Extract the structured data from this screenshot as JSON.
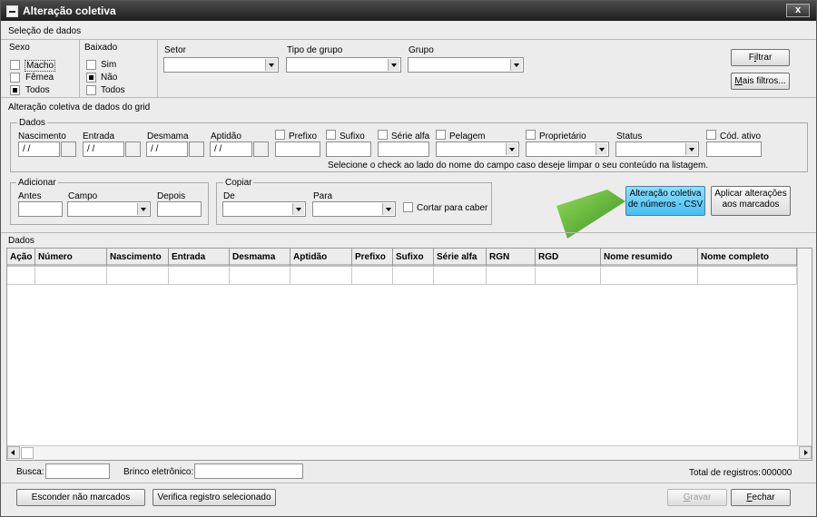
{
  "window": {
    "title": "Alteração coletiva",
    "close": "x"
  },
  "selecao": {
    "header": "Seleção de dados",
    "sexo": {
      "label": "Sexo",
      "options": [
        "Macho",
        "Fêmea",
        "Todos"
      ],
      "checked": [
        false,
        false,
        true
      ]
    },
    "baixado": {
      "label": "Baixado",
      "options": [
        "Sim",
        "Não",
        "Todos"
      ],
      "checked": [
        false,
        true,
        false
      ]
    },
    "setor": "Setor",
    "tipo_grupo": "Tipo de grupo",
    "grupo": "Grupo",
    "filtrar": {
      "pre": "F",
      "u": "i",
      "post": "ltrar"
    },
    "mais_filtros": {
      "pre": "",
      "u": "M",
      "post": "ais filtros..."
    }
  },
  "alteracao": {
    "header": "Alteração coletiva de dados do grid",
    "dados_legend": "Dados",
    "nascimento": "Nascimento",
    "entrada": "Entrada",
    "desmama": "Desmama",
    "aptidao": "Aptidão",
    "date_value": " / /",
    "prefixo": "Prefixo",
    "sufixo": "Sufixo",
    "serie_alfa": "Série alfa",
    "pelagem": "Pelagem",
    "proprietario": "Proprietário",
    "status": "Status",
    "cod_ativo": "Cód. ativo",
    "hint": "Selecione o check ao lado do nome do campo caso deseje limpar o seu conteúdo na listagem."
  },
  "adicionar": {
    "legend": "Adicionar",
    "antes": "Antes",
    "campo": "Campo",
    "depois": "Depois"
  },
  "copiar": {
    "legend": "Copiar",
    "de": "De",
    "para": "Para",
    "cortar": "Cortar para caber"
  },
  "actions": {
    "csv_line1": "Alteração coletiva",
    "csv_line2": "de números - CSV",
    "aplicar_line1": "Aplicar alterações",
    "aplicar_line2": "aos marcados"
  },
  "grid": {
    "header": "Dados",
    "columns": [
      "Ação",
      "Número",
      "Nascimento",
      "Entrada",
      "Desmama",
      "Aptidão",
      "Prefixo",
      "Sufixo",
      "Série alfa",
      "RGN",
      "RGD",
      "Nome resumido",
      "Nome completo"
    ]
  },
  "footer": {
    "busca": "Busca:",
    "brinco": "Brinco eletrônico:",
    "total_label": "Total de registros:",
    "total_value": "000000",
    "esconder": "Esconder não marcados",
    "verifica": "Verifica registro selecionado",
    "gravar": {
      "pre": "",
      "u": "G",
      "post": "ravar"
    },
    "fechar": {
      "pre": "",
      "u": "F",
      "post": "echar"
    }
  },
  "colors": {
    "title_bar": "#2a2a2a",
    "csv_button": "#5ccaf5",
    "arrow": "#5aa830"
  }
}
